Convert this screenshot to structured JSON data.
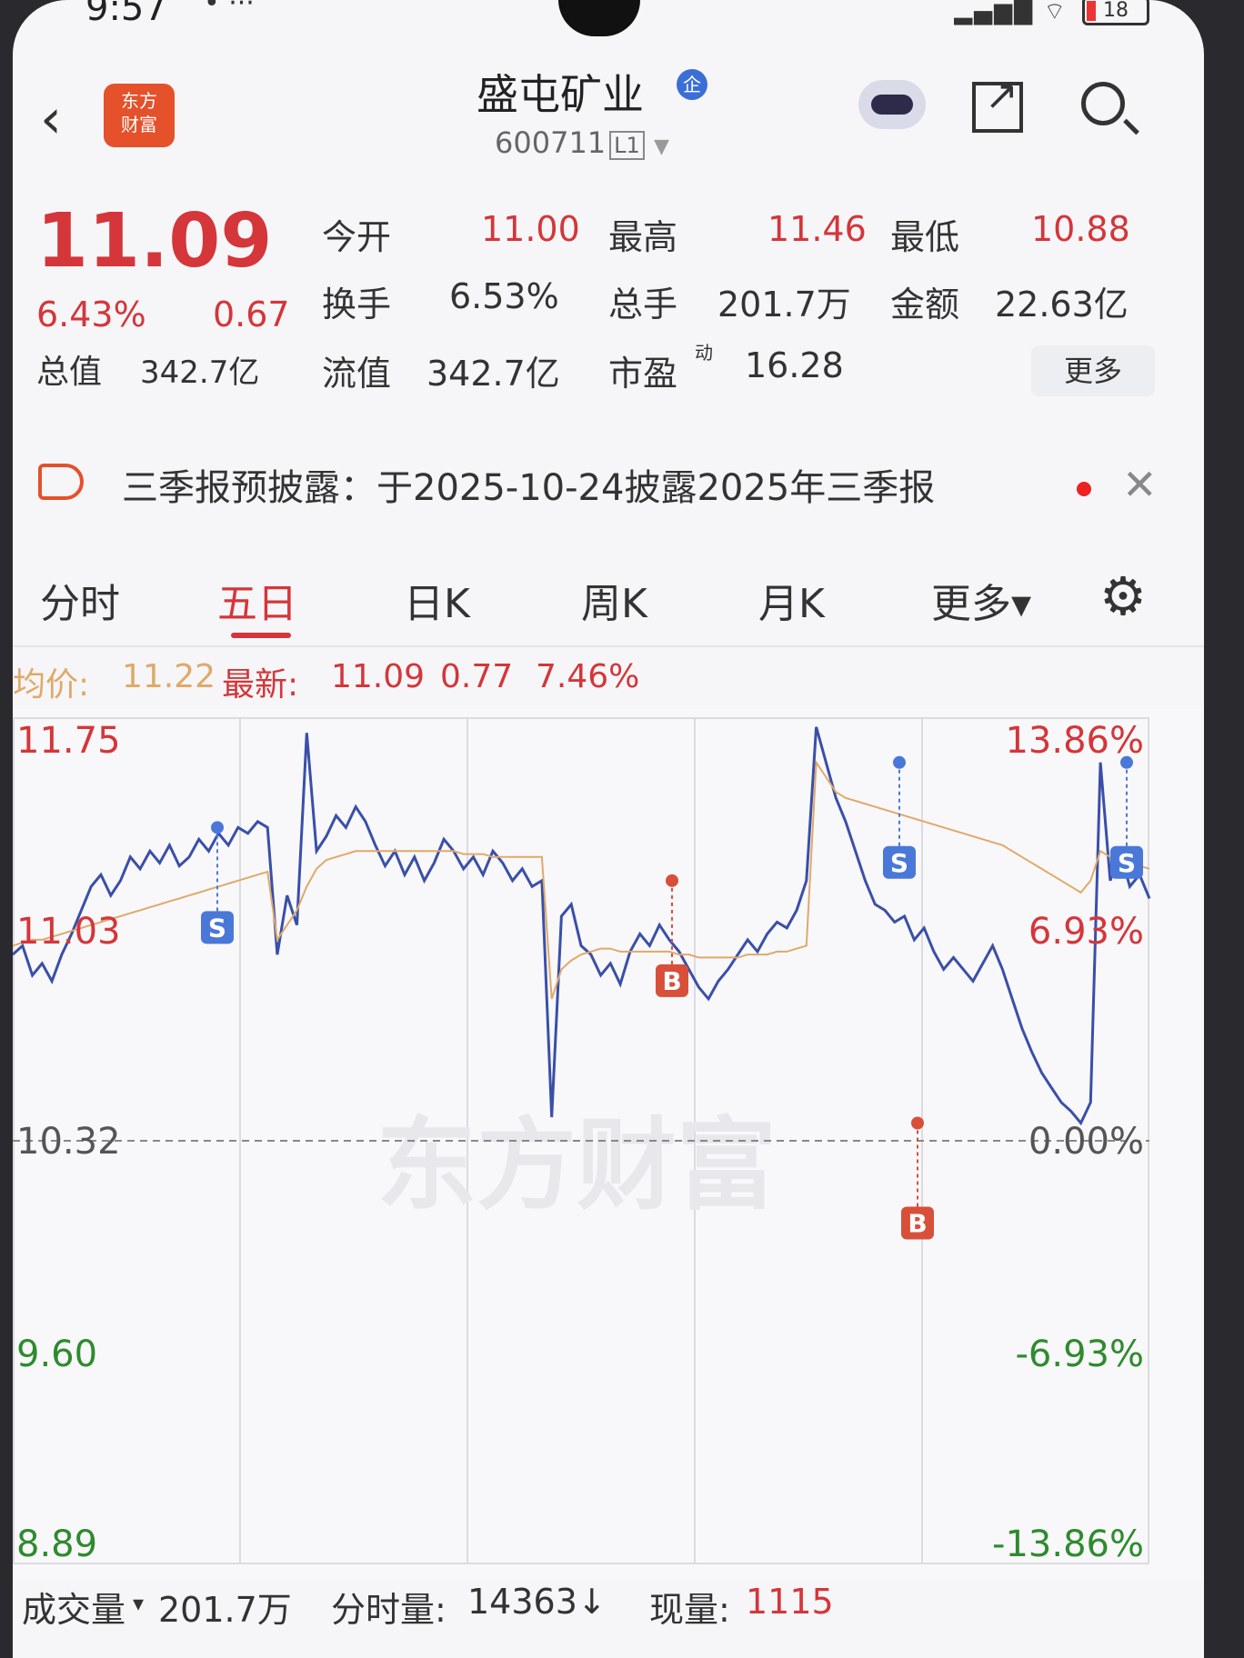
{
  "status_bar": {
    "time": "9:57",
    "dots": "•  ···",
    "battery": "18"
  },
  "header": {
    "logo_text": "东方\n财富",
    "title": "盛屯矿业",
    "badge": "企",
    "code": "600711",
    "level": "L1"
  },
  "quote": {
    "price": "11.09",
    "change_pct": "6.43%",
    "change": "0.67",
    "open_label": "今开",
    "open": "11.00",
    "high_label": "最高",
    "high": "11.46",
    "low_label": "最低",
    "low": "10.88",
    "turnover_label": "换手",
    "turnover": "6.53%",
    "volume_label": "总手",
    "volume": "201.7万",
    "amount_label": "金额",
    "amount": "22.63亿",
    "mcap_label": "总值",
    "mcap": "342.7亿",
    "float_label": "流值",
    "float": "342.7亿",
    "pe_label": "市盈",
    "pe_sup": "动",
    "pe": "16.28",
    "more": "更多"
  },
  "notice": {
    "text": "三季报预披露：于2025-10-24披露2025年三季报"
  },
  "tabs": [
    "分时",
    "五日",
    "日K",
    "周K",
    "月K",
    "更多▾"
  ],
  "legend": {
    "avg_label": "均价:",
    "avg": "11.22",
    "latest_label": "最新:",
    "latest": "11.09",
    "chg": "0.77",
    "pct": "7.46%"
  },
  "colors": {
    "up": "#d4363a",
    "down": "#2e8b2e",
    "line": "#3a4fa8",
    "avg": "#e0a968"
  },
  "chart_data": {
    "type": "line",
    "title": "",
    "y_left_ticks": [
      "11.75",
      "11.03",
      "10.32",
      "9.60",
      "8.89"
    ],
    "y_right_ticks": [
      "13.86%",
      "6.93%",
      "0.00%",
      "-6.93%",
      "-13.86%"
    ],
    "ylim": [
      8.89,
      11.75
    ],
    "base": 10.32,
    "days": 5,
    "series": [
      {
        "values": [
          10.95,
          10.98,
          10.88,
          10.92,
          10.86,
          10.95,
          11.02,
          11.1,
          11.18,
          11.22,
          11.15,
          11.2,
          11.28,
          11.24,
          11.3,
          11.26,
          11.32,
          11.25,
          11.28,
          11.34,
          11.3,
          11.36,
          11.32,
          11.38,
          11.36,
          11.4,
          11.38,
          10.95,
          11.15,
          11.05,
          11.7,
          11.3,
          11.35,
          11.42,
          11.38,
          11.45,
          11.4,
          11.32,
          11.25,
          11.3,
          11.22,
          11.28,
          11.2,
          11.26,
          11.34,
          11.3,
          11.24,
          11.28,
          11.22,
          11.3,
          11.26,
          11.2,
          11.24,
          11.18,
          11.2,
          10.4,
          11.08,
          11.12,
          10.98,
          10.95,
          10.88,
          10.92,
          10.85,
          10.96,
          11.02,
          10.98,
          11.05,
          11.0,
          10.96,
          10.9,
          10.84,
          10.8,
          10.86,
          10.9,
          10.95,
          11.0,
          10.96,
          11.02,
          11.06,
          11.04,
          11.1,
          11.2,
          11.72,
          11.6,
          11.48,
          11.4,
          11.3,
          11.2,
          11.12,
          11.1,
          11.06,
          11.08,
          11.0,
          11.04,
          10.96,
          10.9,
          10.94,
          10.9,
          10.86,
          10.92,
          10.98,
          10.9,
          10.8,
          10.7,
          10.62,
          10.55,
          10.5,
          10.45,
          10.42,
          10.38,
          10.45,
          11.6,
          11.2,
          11.3,
          11.18,
          11.22,
          11.14
        ]
      },
      {
        "values": [
          10.98,
          10.99,
          11.0,
          11.0,
          11.01,
          11.02,
          11.03,
          11.04,
          11.05,
          11.06,
          11.07,
          11.08,
          11.09,
          11.1,
          11.11,
          11.12,
          11.13,
          11.14,
          11.15,
          11.16,
          11.17,
          11.18,
          11.19,
          11.2,
          11.21,
          11.22,
          11.23,
          11.0,
          11.05,
          11.1,
          11.18,
          11.24,
          11.27,
          11.28,
          11.29,
          11.3,
          11.3,
          11.3,
          11.3,
          11.3,
          11.3,
          11.3,
          11.3,
          11.3,
          11.3,
          11.3,
          11.29,
          11.29,
          11.29,
          11.28,
          11.28,
          11.28,
          11.28,
          11.28,
          11.28,
          10.8,
          10.9,
          10.93,
          10.95,
          10.96,
          10.97,
          10.97,
          10.96,
          10.96,
          10.96,
          10.96,
          10.96,
          10.96,
          10.95,
          10.95,
          10.94,
          10.94,
          10.94,
          10.94,
          10.94,
          10.95,
          10.95,
          10.95,
          10.96,
          10.96,
          10.97,
          10.98,
          11.6,
          11.55,
          11.5,
          11.48,
          11.47,
          11.46,
          11.45,
          11.44,
          11.43,
          11.42,
          11.41,
          11.4,
          11.39,
          11.38,
          11.37,
          11.36,
          11.35,
          11.34,
          11.33,
          11.32,
          11.3,
          11.28,
          11.26,
          11.24,
          11.22,
          11.2,
          11.18,
          11.16,
          11.2,
          11.3,
          11.28,
          11.27,
          11.26,
          11.25,
          11.24
        ]
      }
    ],
    "signals": [
      {
        "type": "S",
        "day": 1,
        "price": 11.38
      },
      {
        "type": "B",
        "day": 3,
        "price": 11.2
      },
      {
        "type": "S",
        "day": 4,
        "price": 11.6
      },
      {
        "type": "B",
        "day": 4,
        "price": 10.38
      },
      {
        "type": "S",
        "day": 5,
        "price": 11.6
      }
    ],
    "watermark": "东方财富"
  },
  "volume_bar": {
    "label": "成交量",
    "value": "201.7万",
    "min_label": "分时量:",
    "min_value": "14363↓",
    "now_label": "现量:",
    "now_value": "1115"
  }
}
